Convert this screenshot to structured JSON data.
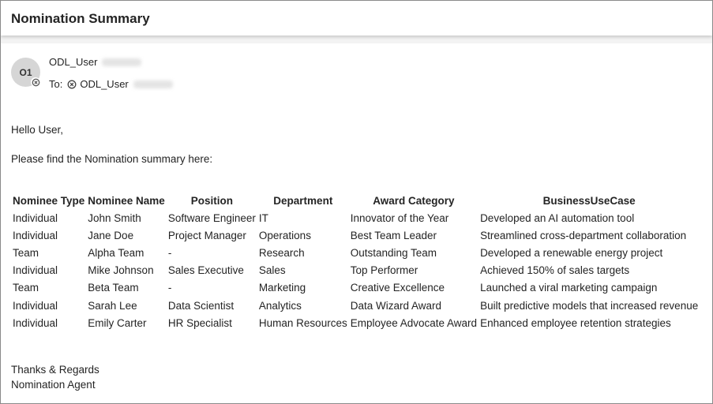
{
  "header": {
    "title": "Nomination Summary"
  },
  "message": {
    "avatar_initials": "O1",
    "sender_name": "ODL_User",
    "to_label": "To:",
    "recipient_name": "ODL_User",
    "greeting": "Hello User,",
    "intro": "Please find the Nomination summary here:",
    "signoff": "Thanks & Regards",
    "signature": "Nomination Agent"
  },
  "table": {
    "headers": [
      "Nominee Type",
      "Nominee Name",
      "Position",
      "Department",
      "Award Category",
      "BusinessUseCase"
    ],
    "rows": [
      [
        "Individual",
        "John Smith",
        "Software Engineer",
        "IT",
        "Innovator of the Year",
        "Developed an AI automation tool"
      ],
      [
        "Individual",
        "Jane Doe",
        "Project Manager",
        "Operations",
        "Best Team Leader",
        "Streamlined cross-department collaboration"
      ],
      [
        "Team",
        "Alpha Team",
        "-",
        "Research",
        "Outstanding Team",
        "Developed a renewable energy project"
      ],
      [
        "Individual",
        "Mike Johnson",
        "Sales Executive",
        "Sales",
        "Top Performer",
        "Achieved 150% of sales targets"
      ],
      [
        "Team",
        "Beta Team",
        "-",
        "Marketing",
        "Creative Excellence",
        "Launched a viral marketing campaign"
      ],
      [
        "Individual",
        "Sarah Lee",
        "Data Scientist",
        "Analytics",
        "Data Wizard Award",
        "Built predictive models that increased revenue"
      ],
      [
        "Individual",
        "Emily Carter",
        "HR Specialist",
        "Human Resources",
        "Employee Advocate Award",
        "Enhanced employee retention strategies"
      ]
    ]
  },
  "icons": {
    "presence": "circle-x-icon",
    "recipient": "circle-x-icon"
  }
}
